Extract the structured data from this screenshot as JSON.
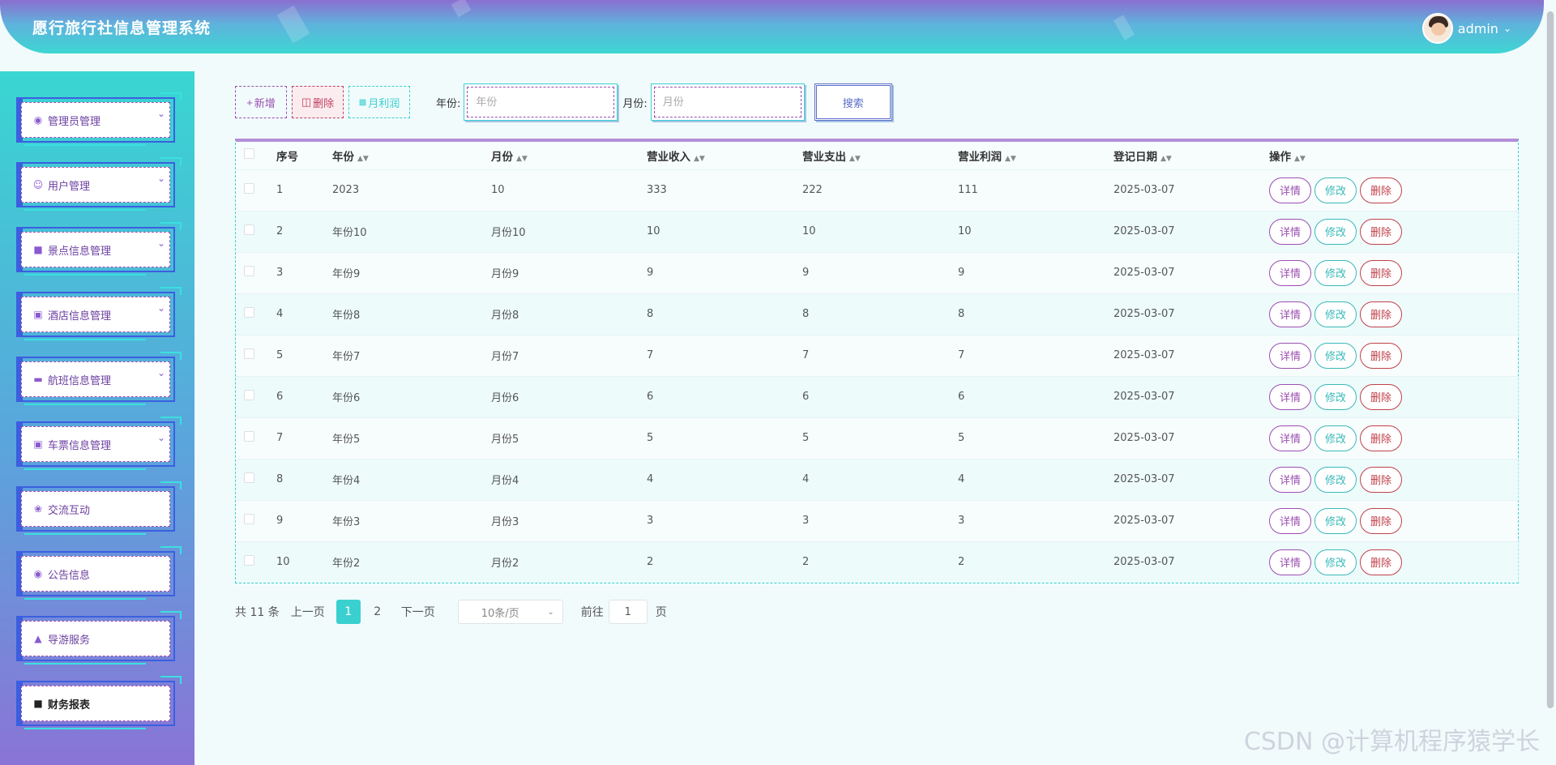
{
  "header": {
    "title": "愿行旅行社信息管理系统",
    "username": "admin",
    "dropdown_icon": "chevron-down-icon"
  },
  "sidebar": {
    "items": [
      {
        "label": "管理员管理",
        "icon": "circle-icon",
        "expandable": true
      },
      {
        "label": "用户管理",
        "icon": "person-icon",
        "expandable": true
      },
      {
        "label": "景点信息管理",
        "icon": "square-icon",
        "expandable": true
      },
      {
        "label": "酒店信息管理",
        "icon": "book-icon",
        "expandable": true
      },
      {
        "label": "航班信息管理",
        "icon": "card-icon",
        "expandable": true
      },
      {
        "label": "车票信息管理",
        "icon": "book-icon",
        "expandable": true
      },
      {
        "label": "交流互动",
        "icon": "chat-icon",
        "expandable": false
      },
      {
        "label": "公告信息",
        "icon": "circle-icon",
        "expandable": false
      },
      {
        "label": "导游服务",
        "icon": "thumb-icon",
        "expandable": false
      },
      {
        "label": "财务报表",
        "icon": "report-icon",
        "expandable": false,
        "active": true
      }
    ]
  },
  "toolbar": {
    "add_label": "新增",
    "delete_label": "删除",
    "profit_label": "月利润",
    "year_label": "年份:",
    "year_placeholder": "年份",
    "month_label": "月份:",
    "month_placeholder": "月份",
    "search_label": "搜索"
  },
  "table": {
    "columns": [
      "序号",
      "年份",
      "月份",
      "营业收入",
      "营业支出",
      "营业利润",
      "登记日期",
      "操作"
    ],
    "rows": [
      {
        "no": "1",
        "year": "2023",
        "month": "10",
        "income": "333",
        "expense": "222",
        "profit": "111",
        "date": "2025-03-07"
      },
      {
        "no": "2",
        "year": "年份10",
        "month": "月份10",
        "income": "10",
        "expense": "10",
        "profit": "10",
        "date": "2025-03-07"
      },
      {
        "no": "3",
        "year": "年份9",
        "month": "月份9",
        "income": "9",
        "expense": "9",
        "profit": "9",
        "date": "2025-03-07"
      },
      {
        "no": "4",
        "year": "年份8",
        "month": "月份8",
        "income": "8",
        "expense": "8",
        "profit": "8",
        "date": "2025-03-07"
      },
      {
        "no": "5",
        "year": "年份7",
        "month": "月份7",
        "income": "7",
        "expense": "7",
        "profit": "7",
        "date": "2025-03-07"
      },
      {
        "no": "6",
        "year": "年份6",
        "month": "月份6",
        "income": "6",
        "expense": "6",
        "profit": "6",
        "date": "2025-03-07"
      },
      {
        "no": "7",
        "year": "年份5",
        "month": "月份5",
        "income": "5",
        "expense": "5",
        "profit": "5",
        "date": "2025-03-07"
      },
      {
        "no": "8",
        "year": "年份4",
        "month": "月份4",
        "income": "4",
        "expense": "4",
        "profit": "4",
        "date": "2025-03-07"
      },
      {
        "no": "9",
        "year": "年份3",
        "month": "月份3",
        "income": "3",
        "expense": "3",
        "profit": "3",
        "date": "2025-03-07"
      },
      {
        "no": "10",
        "year": "年份2",
        "month": "月份2",
        "income": "2",
        "expense": "2",
        "profit": "2",
        "date": "2025-03-07"
      }
    ],
    "actions": {
      "detail": "详情",
      "edit": "修改",
      "delete": "删除"
    }
  },
  "pagination": {
    "total": "共 11 条",
    "prev": "上一页",
    "pages": [
      "1",
      "2"
    ],
    "current": "1",
    "next": "下一页",
    "page_size": "10条/页",
    "goto_label": "前往",
    "goto_value": "1",
    "page_suffix": "页"
  },
  "watermark": "CSDN @计算机程序猿学长",
  "colors": {
    "accent": "#3ad0d0",
    "purple": "#9b4fb0",
    "danger": "#c0404a",
    "sidebar_top": "#39d6d2",
    "sidebar_bottom": "#8a74d6"
  }
}
